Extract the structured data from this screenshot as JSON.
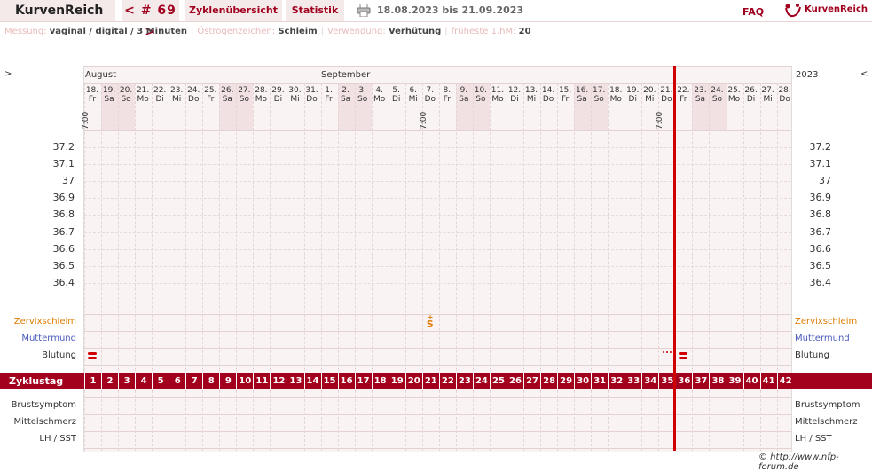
{
  "nav": {
    "brand": "KurvenReich",
    "cycle": "< # 69 >",
    "tab_zyklus": "Zyklenübersicht",
    "tab_statistik": "Statistik",
    "date_range": "18.08.2023 bis 21.09.2023",
    "faq": "FAQ",
    "logo_text": "KurvenReich"
  },
  "info": {
    "messung_label": "Messung:",
    "messung_value": "vaginal / digital / 3 Minuten",
    "oestrogen_label": "Östrogenzeichen:",
    "oestrogen_value": "Schleim",
    "verwendung_label": "Verwendung:",
    "verwendung_value": "Verhütung",
    "hm_label": "früheste 1.hM:",
    "hm_value": "20"
  },
  "chart": {
    "left_arrow": ">",
    "right_arrow": "<",
    "year": "2023",
    "month1": "August",
    "month2": "September",
    "days": [
      {
        "d": "18.",
        "w": "Fr"
      },
      {
        "d": "19.",
        "w": "Sa"
      },
      {
        "d": "20.",
        "w": "So"
      },
      {
        "d": "21.",
        "w": "Mo"
      },
      {
        "d": "22.",
        "w": "Di"
      },
      {
        "d": "23.",
        "w": "Mi"
      },
      {
        "d": "24.",
        "w": "Do"
      },
      {
        "d": "25.",
        "w": "Fr"
      },
      {
        "d": "26.",
        "w": "Sa"
      },
      {
        "d": "27.",
        "w": "So"
      },
      {
        "d": "28.",
        "w": "Mo"
      },
      {
        "d": "29.",
        "w": "Di"
      },
      {
        "d": "30.",
        "w": "Mi"
      },
      {
        "d": "31.",
        "w": "Do"
      },
      {
        "d": "1.",
        "w": "Fr"
      },
      {
        "d": "2.",
        "w": "Sa"
      },
      {
        "d": "3.",
        "w": "So"
      },
      {
        "d": "4.",
        "w": "Mo"
      },
      {
        "d": "5.",
        "w": "Di"
      },
      {
        "d": "6.",
        "w": "Mi"
      },
      {
        "d": "7.",
        "w": "Do"
      },
      {
        "d": "8.",
        "w": "Fr"
      },
      {
        "d": "9.",
        "w": "Sa"
      },
      {
        "d": "10.",
        "w": "So"
      },
      {
        "d": "11.",
        "w": "Mo"
      },
      {
        "d": "12.",
        "w": "Di"
      },
      {
        "d": "13.",
        "w": "Mi"
      },
      {
        "d": "14.",
        "w": "Do"
      },
      {
        "d": "15.",
        "w": "Fr"
      },
      {
        "d": "16.",
        "w": "Sa"
      },
      {
        "d": "17.",
        "w": "So"
      },
      {
        "d": "18.",
        "w": "Mo"
      },
      {
        "d": "19.",
        "w": "Di"
      },
      {
        "d": "20.",
        "w": "Mi"
      },
      {
        "d": "21.",
        "w": "Do"
      },
      {
        "d": "22.",
        "w": "Fr"
      },
      {
        "d": "23.",
        "w": "Sa"
      },
      {
        "d": "24.",
        "w": "So"
      },
      {
        "d": "25.",
        "w": "Mo"
      },
      {
        "d": "26.",
        "w": "Di"
      },
      {
        "d": "27.",
        "w": "Mi"
      },
      {
        "d": "28.",
        "w": "Do"
      }
    ],
    "time_marks": [
      {
        "day_index": 0,
        "time": "7:00"
      },
      {
        "day_index": 20,
        "time": "7:00"
      },
      {
        "day_index": 34,
        "time": "7:00"
      }
    ],
    "temps": [
      "37.2",
      "37.1",
      "37",
      "36.9",
      "36.8",
      "36.7",
      "36.6",
      "36.5",
      "36.4"
    ],
    "rows": {
      "zervix": "Zervixschleim",
      "muttermund": "Muttermund",
      "blutung": "Blutung",
      "zyklustag": "Zyklustag",
      "brust": "Brustsymptom",
      "mittel": "Mittelschmerz",
      "lh": "LH / SST"
    },
    "cervix_entry": {
      "day_index": 20,
      "mark": "S",
      "sign": "+"
    },
    "bleeding": [
      {
        "day_index": 0,
        "type": "strong"
      },
      {
        "day_index": 34,
        "type": "spotting"
      },
      {
        "day_index": 35,
        "type": "strong"
      }
    ],
    "cycle_days": [
      "1",
      "2",
      "3",
      "4",
      "5",
      "6",
      "7",
      "8",
      "9",
      "10",
      "11",
      "12",
      "13",
      "14",
      "15",
      "16",
      "17",
      "18",
      "19",
      "20",
      "21",
      "22",
      "23",
      "24",
      "25",
      "26",
      "27",
      "28",
      "29",
      "30",
      "31",
      "32",
      "33",
      "34",
      "35",
      "36",
      "37",
      "38",
      "39",
      "40",
      "41",
      "42"
    ],
    "current_day_index": 35,
    "colors": {
      "accent": "#a3001e",
      "zervix": "#e07b00",
      "muttermund": "#4a5bbd",
      "marker": "#d00000"
    }
  },
  "footer": "© http://www.nfp-forum.de"
}
